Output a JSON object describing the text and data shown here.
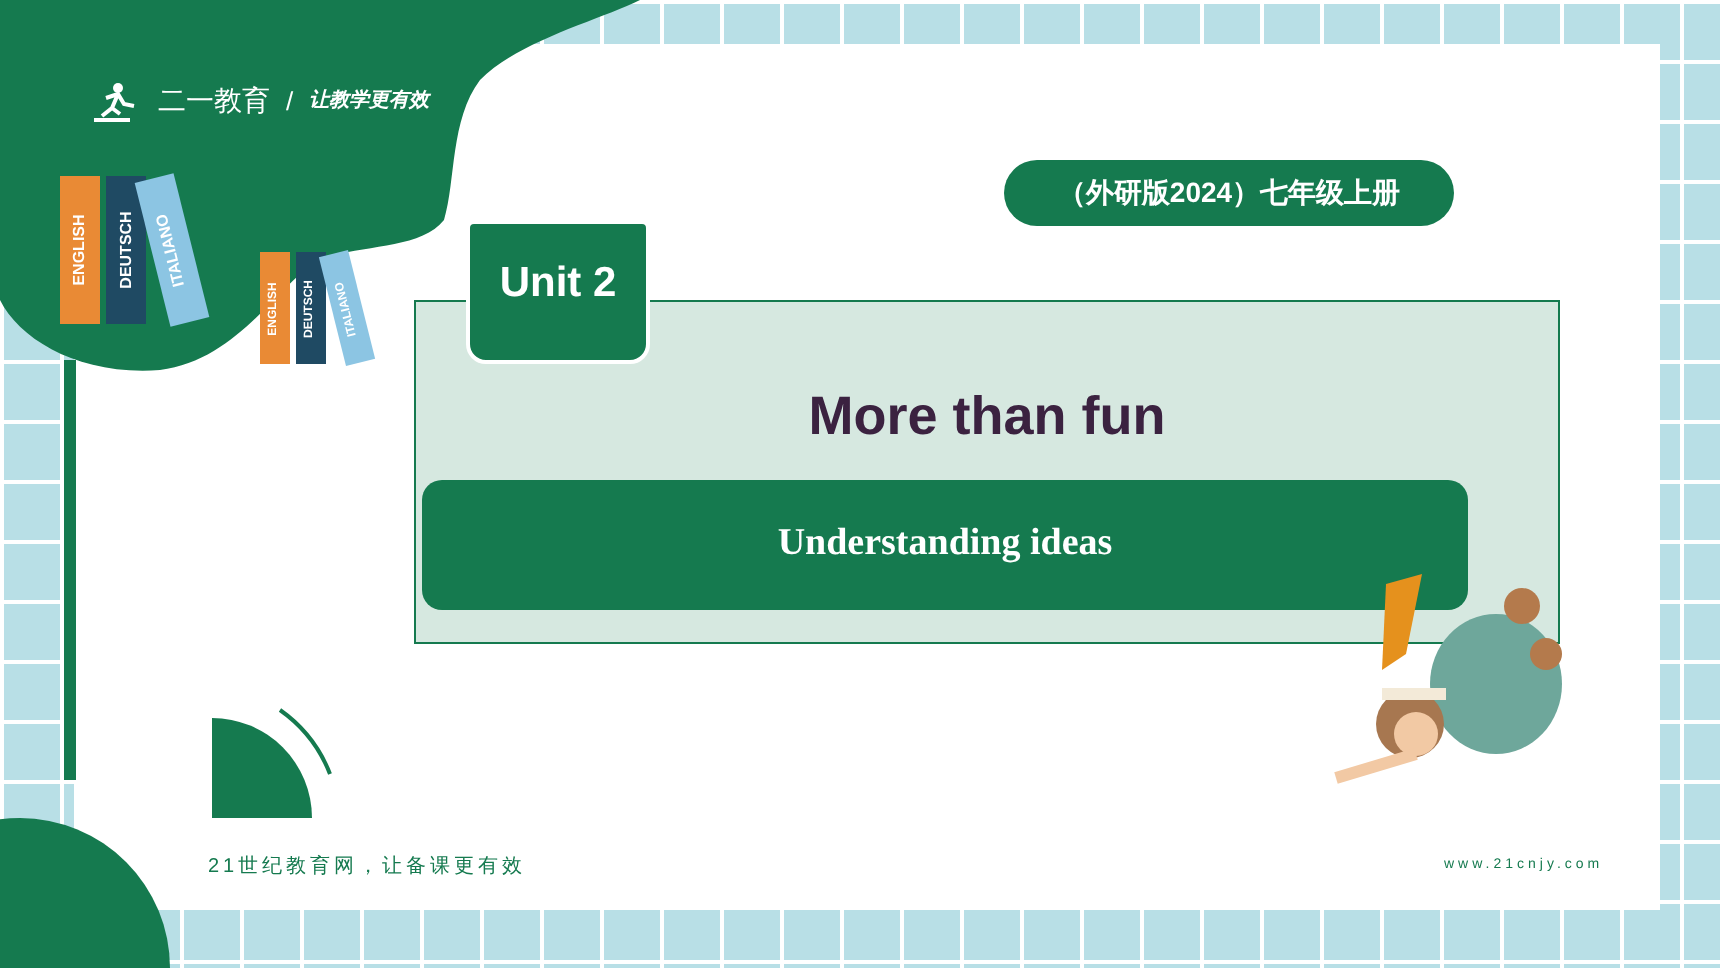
{
  "logo": {
    "name": "二一教育",
    "separator": "/",
    "slogan": "让教学更有效"
  },
  "books": [
    {
      "spines": [
        "ENGLISH",
        "DEUTSCH",
        "ITALIANO"
      ]
    },
    {
      "spines": [
        "ENGLISH",
        "DEUTSCH",
        "ITALIANO"
      ]
    }
  ],
  "edition_badge": "（外研版2024）七年级上册",
  "unit_tab": "Unit 2",
  "title": "More than fun",
  "section_bar": "Understanding ideas",
  "footer": {
    "left": "21世纪教育网，让备课更有效",
    "right": "www.21cnjy.com"
  }
}
